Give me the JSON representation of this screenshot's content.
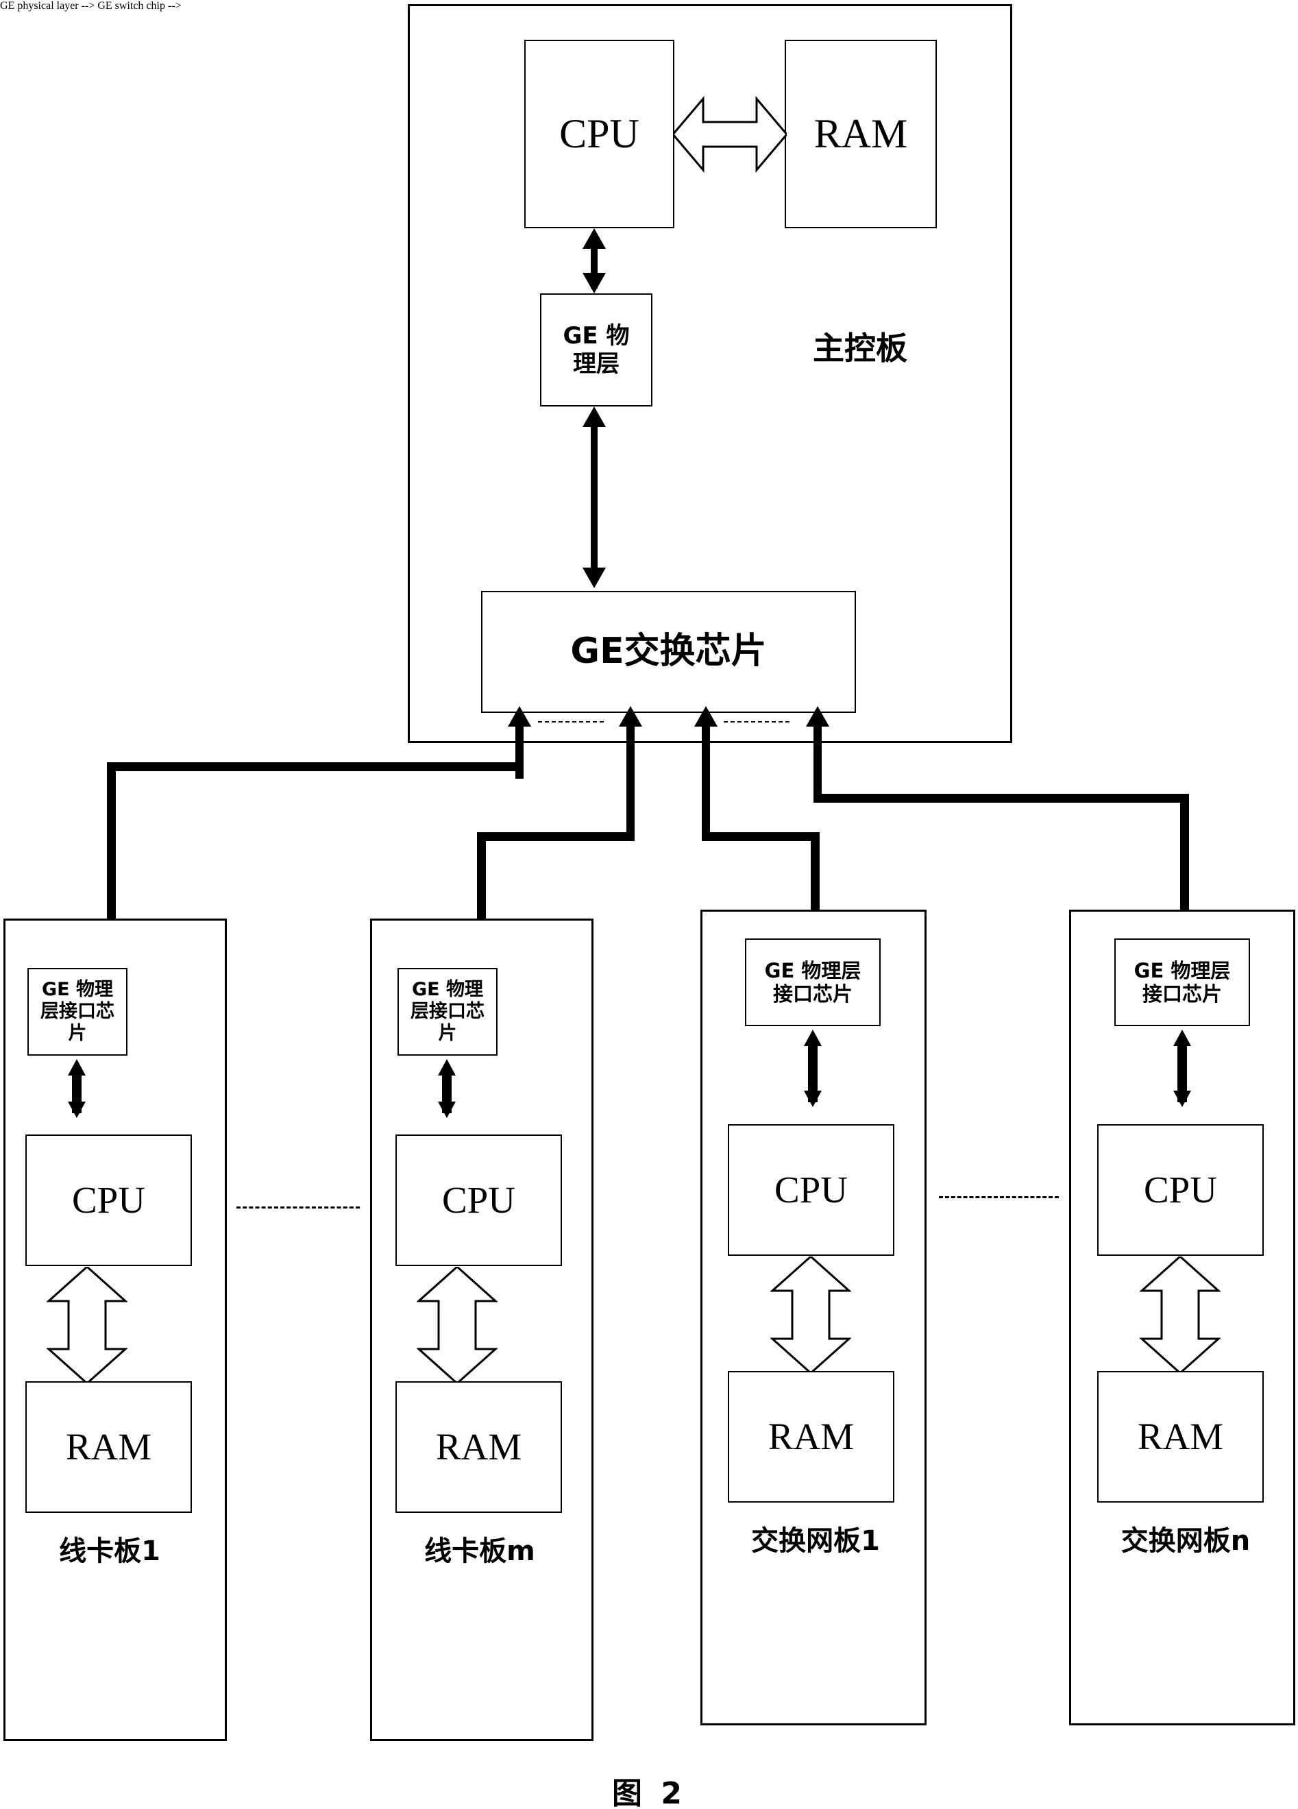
{
  "figure": {
    "caption": "图 2"
  },
  "main_board": {
    "name_label": "主控板",
    "cpu": "CPU",
    "ram": "RAM",
    "ge_phy": "GE 物理层",
    "ge_switch_chip": "GE交换芯片"
  },
  "cards": [
    {
      "id": "line-card-1",
      "board_label": "线卡板1",
      "phy_chip": "GE 物理层接口芯片",
      "cpu": "CPU",
      "ram": "RAM"
    },
    {
      "id": "line-card-m",
      "board_label": "线卡板m",
      "phy_chip": "GE 物理层接口芯片",
      "cpu": "CPU",
      "ram": "RAM"
    },
    {
      "id": "switch-fabric-1",
      "board_label": "交换网板1",
      "phy_chip": "GE 物理层接口芯片",
      "cpu": "CPU",
      "ram": "RAM"
    },
    {
      "id": "switch-fabric-n",
      "board_label": "交换网板n",
      "phy_chip": "GE 物理层接口芯片",
      "cpu": "CPU",
      "ram": "RAM"
    }
  ],
  "colors": {
    "line": "#000000",
    "background": "#ffffff"
  }
}
